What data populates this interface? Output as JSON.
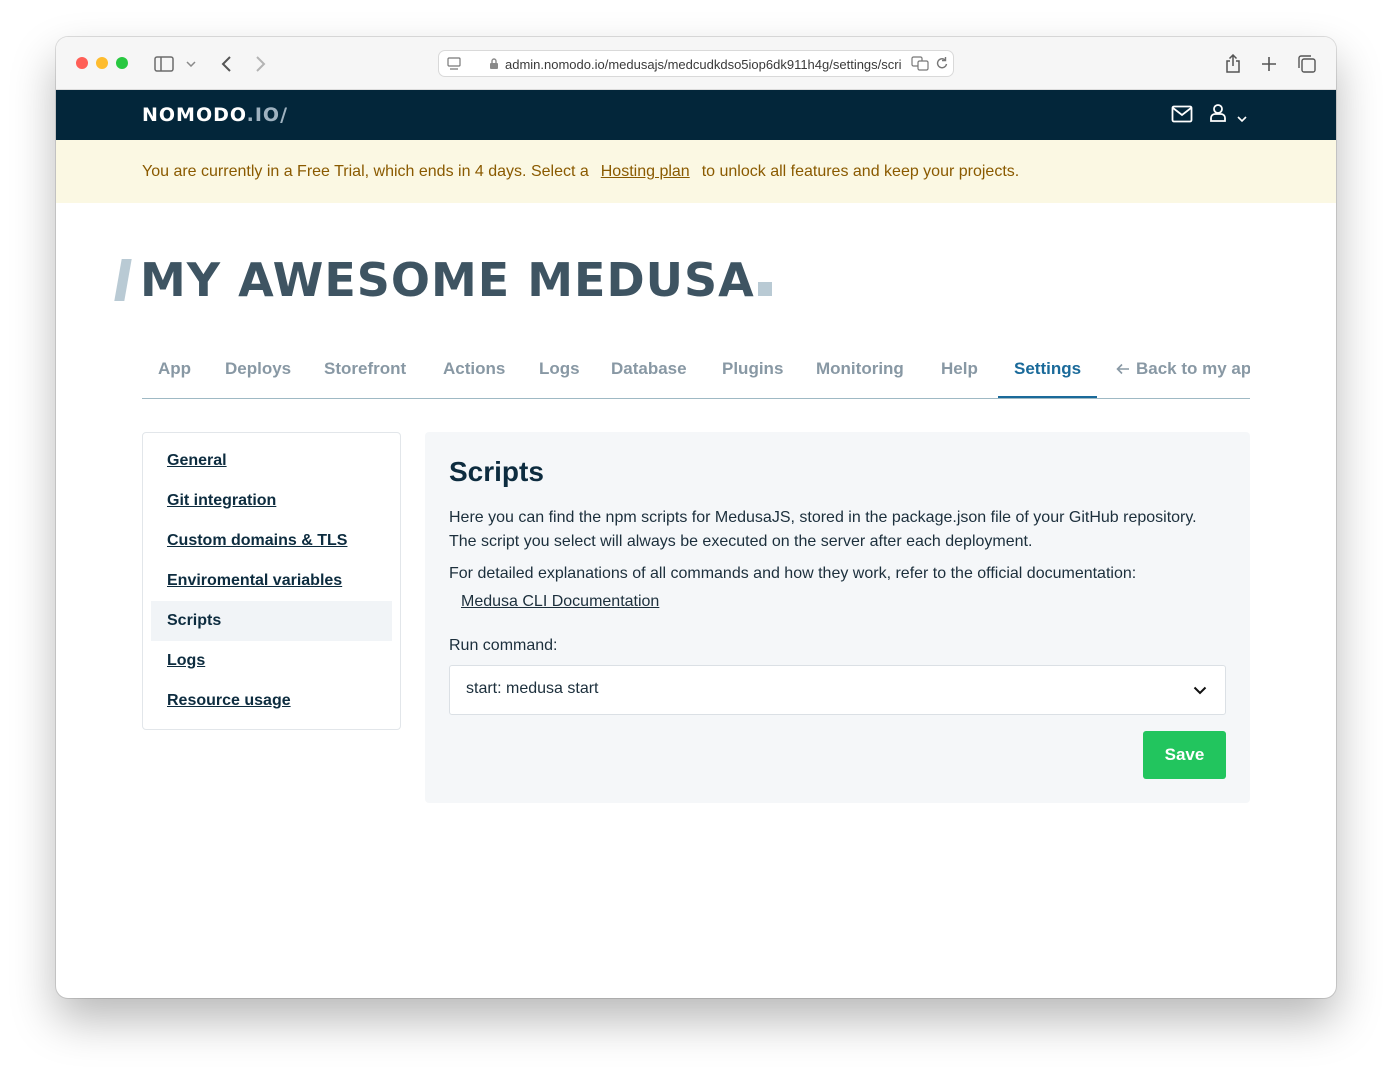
{
  "browser": {
    "url": "admin.nomodo.io/medusajs/medcudkdso5iop6dk911h4g/settings/scripts"
  },
  "header": {
    "logo_main": "NOMODO",
    "logo_accent": ".IO/"
  },
  "banner": {
    "text_before": "You are currently in a Free Trial, which ends in 4 days. Select a",
    "link": "Hosting plan",
    "text_after": "to unlock all features and keep your projects."
  },
  "page_title": "MY AWESOME MEDUSA",
  "tabs": [
    {
      "label": "App"
    },
    {
      "label": "Deploys"
    },
    {
      "label": "Storefront"
    },
    {
      "label": "Actions"
    },
    {
      "label": "Logs"
    },
    {
      "label": "Database"
    },
    {
      "label": "Plugins"
    },
    {
      "label": "Monitoring"
    },
    {
      "label": "Help"
    },
    {
      "label": "Settings",
      "active": true
    },
    {
      "label": "Back to my ap"
    }
  ],
  "sidenav": [
    {
      "label": "General"
    },
    {
      "label": "Git integration"
    },
    {
      "label": "Custom domains & TLS"
    },
    {
      "label": "Enviromental variables"
    },
    {
      "label": "Scripts",
      "active": true
    },
    {
      "label": "Logs"
    },
    {
      "label": "Resource usage"
    }
  ],
  "scripts": {
    "heading": "Scripts",
    "description": "Here you can find the npm scripts for MedusaJS, stored in the package.json file of your GitHub repository. The script you select will always be executed on the server after each deployment.",
    "docs_text": "For detailed explanations of all commands and how they work, refer to the official documentation:",
    "docs_link": "Medusa CLI Documentation",
    "run_label": "Run command:",
    "run_value": "start: medusa start",
    "save_label": "Save"
  },
  "colors": {
    "header_bg": "#03263a",
    "banner_bg": "#fbf8e3",
    "active_tab": "#1a6a9a",
    "save_button": "#22c55e"
  }
}
